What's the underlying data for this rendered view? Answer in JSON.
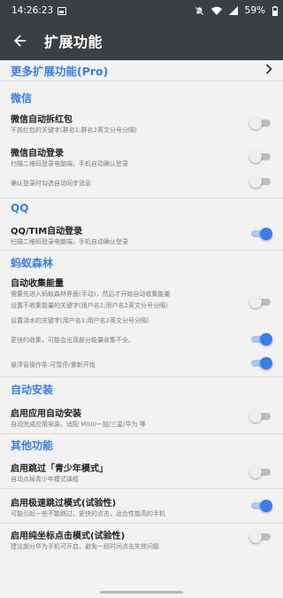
{
  "status_bar": {
    "time": "14:26:23",
    "battery": "59%"
  },
  "app_bar": {
    "title": "扩展功能",
    "back_icon": "arrow-back-icon"
  },
  "more_features": {
    "label": "更多扩展功能(Pro)"
  },
  "sections": {
    "wechat": "微信",
    "qq": "QQ",
    "ant_forest": "蚂蚁森林",
    "auto_install": "自动安装",
    "other": "其他功能"
  },
  "items": {
    "wechat_redpacket": {
      "title": "微信自动拆红包",
      "subtitle": "不拆红包的关键字(群名1;群名2英文分号分隔)",
      "enabled": false
    },
    "wechat_login": {
      "title": "微信自动登录",
      "subtitle": "扫描二维码登录电脑端，手机自动确认登录",
      "enabled": false
    },
    "wechat_sync": {
      "subtitle": "确认登录时勾选自动同步消息",
      "enabled": false
    },
    "qq_login": {
      "title": "QQ/TIM自动登录",
      "subtitle": "扫描二维码登录电脑端，手机自动确认登录",
      "enabled": true
    },
    "forest_collect": {
      "title": "自动收集能量",
      "subtitle_1": "需要先进入蚂蚁森林界面(手动)，然后才开始自动收集能量",
      "subtitle_2": "设置不收集能量的关键字(用户名1;用户名2英文分号分隔)",
      "subtitle_3": "设置浇水的关键字(用户名1;用户名2英文分号分隔)",
      "enabled": false
    },
    "forest_fast": {
      "subtitle": "更快的收集，可能会出现部分能量收集不全。",
      "enabled": true
    },
    "forest_float": {
      "subtitle": "悬浮窗操作条:可暂停/重新开始",
      "enabled": true
    },
    "auto_install": {
      "title": "启用应用自动安装",
      "subtitle": "自动完成应用安装，适配 MIUI/一加/三星/华为 等",
      "enabled": false
    },
    "skip_youth": {
      "title": "启用跳过「青少年模式」",
      "subtitle": "自动点掉青少年模式弹框",
      "enabled": false
    },
    "fast_skip": {
      "title": "启用极速跳过模式(试验性)",
      "subtitle": "可能引起一些不能跳过，更快的点击，适合性能高的手机",
      "enabled": true
    },
    "coord_click": {
      "title": "启用纯坐标点击模式(试验性)",
      "subtitle": "建议部分华为手机可开启，避免一段时间点击失效问题",
      "enabled": false
    }
  },
  "colors": {
    "accent": "#3a7ee8",
    "bar": "#3c3f42",
    "background": "#f2f2f2"
  }
}
